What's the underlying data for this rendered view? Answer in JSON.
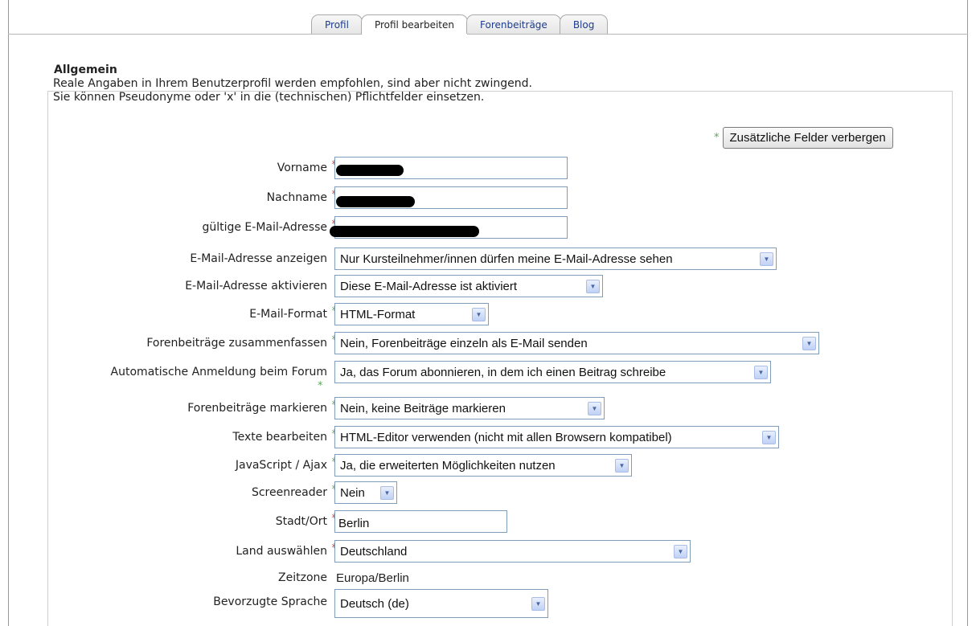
{
  "tabs": [
    {
      "label": "Profil",
      "active": false
    },
    {
      "label": "Profil bearbeiten",
      "active": true
    },
    {
      "label": "Forenbeiträge",
      "active": false
    },
    {
      "label": "Blog",
      "active": false
    }
  ],
  "section": {
    "title": "Allgemein",
    "intro_line1": "Reale Angaben in Ihrem Benutzerprofil werden empfohlen, sind aber nicht zwingend.",
    "intro_line2": "Sie können Pseudonyme oder 'x' in die (technischen) Pflichtfelder einsetzen."
  },
  "toggle_button": {
    "label": "Zusätzliche Felder verbergen"
  },
  "marks": {
    "required": "*",
    "optional": "*"
  },
  "fields": {
    "vorname": {
      "label": "Vorname",
      "value": ""
    },
    "nachname": {
      "label": "Nachname",
      "value": ""
    },
    "email": {
      "label": "gültige E-Mail-Adresse",
      "value": ""
    },
    "email_display": {
      "label": "E-Mail-Adresse anzeigen",
      "value": "Nur Kursteilnehmer/innen dürfen meine E-Mail-Adresse sehen"
    },
    "email_enable": {
      "label": "E-Mail-Adresse aktivieren",
      "value": "Diese E-Mail-Adresse ist aktiviert"
    },
    "email_format": {
      "label": "E-Mail-Format",
      "value": "HTML-Format"
    },
    "forum_digest": {
      "label": "Forenbeiträge zusammenfassen",
      "value": "Nein, Forenbeiträge einzeln als E-Mail senden"
    },
    "auto_subscribe": {
      "label": "Automatische Anmeldung beim Forum",
      "value": "Ja, das Forum abonnieren, in dem ich einen Beitrag schreibe"
    },
    "track_forums": {
      "label": "Forenbeiträge markieren",
      "value": "Nein, keine Beiträge markieren"
    },
    "html_editor": {
      "label": "Texte bearbeiten",
      "value": "HTML-Editor verwenden (nicht mit allen Browsern kompatibel)"
    },
    "ajax": {
      "label": "JavaScript / Ajax",
      "value": "Ja, die erweiterten Möglichkeiten nutzen"
    },
    "screenreader": {
      "label": "Screenreader",
      "value": "Nein"
    },
    "city": {
      "label": "Stadt/Ort",
      "value": "Berlin"
    },
    "country": {
      "label": "Land auswählen",
      "value": "Deutschland"
    },
    "timezone": {
      "label": "Zeitzone",
      "value": "Europa/Berlin"
    },
    "language": {
      "label": "Bevorzugte Sprache",
      "value": "Deutsch (de)"
    }
  }
}
